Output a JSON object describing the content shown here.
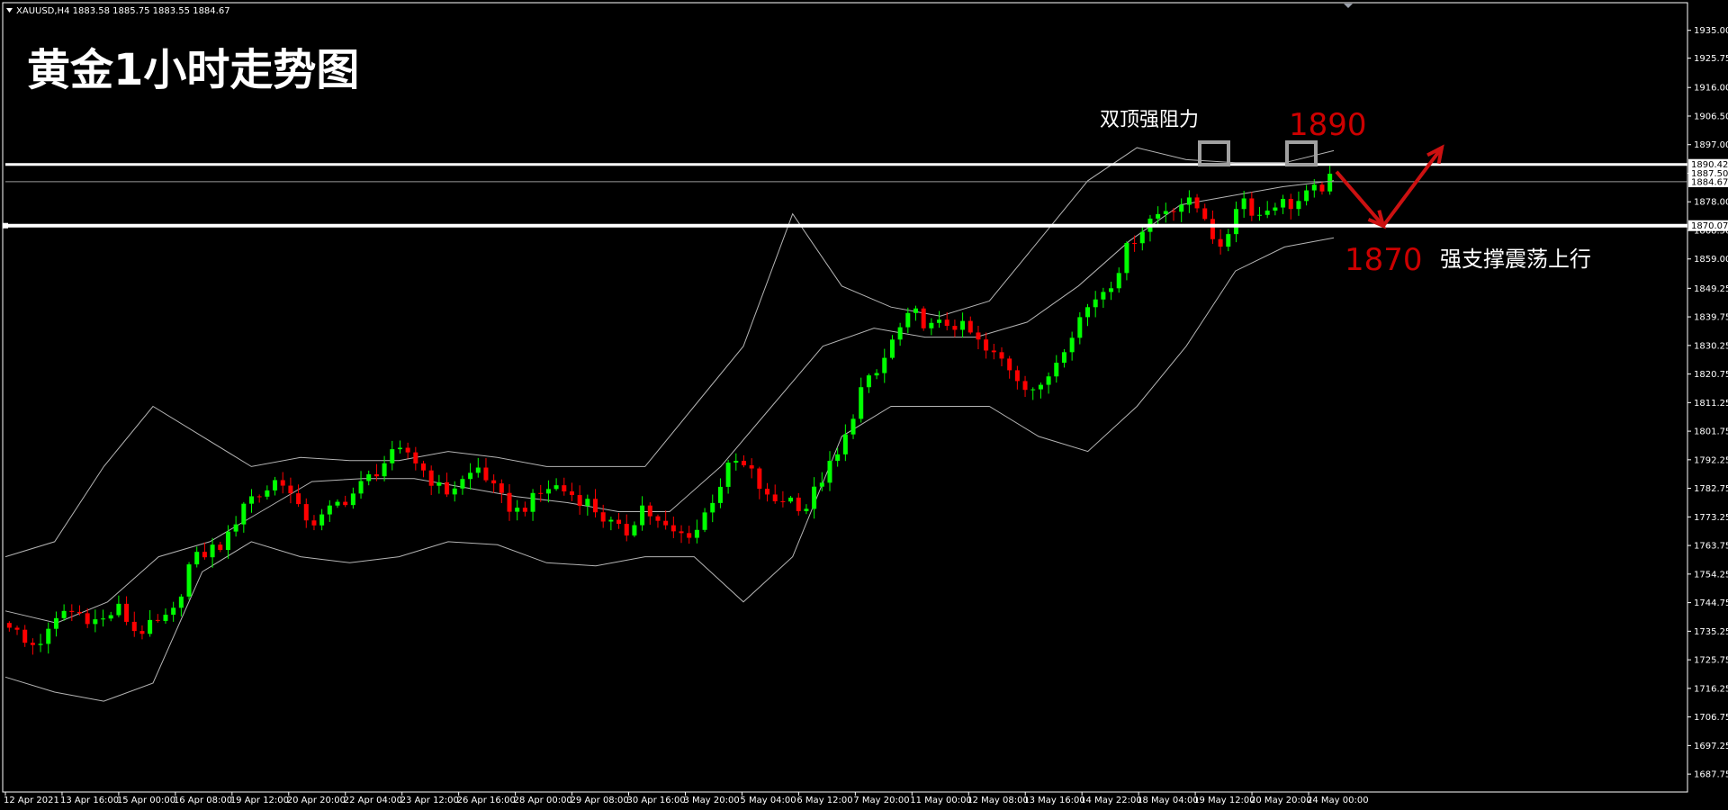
{
  "window": {
    "header": "XAUUSD,H4  1883.58 1885.75 1883.55 1884.67",
    "collapse_icon": "triangle-down-icon"
  },
  "annotations": {
    "title": "黄金1小时走势图",
    "resistance_label": "双顶强阻力",
    "resistance_price": "1890",
    "support_price": "1870",
    "support_label": "强支撑震荡上行"
  },
  "price_labels": {
    "resistance_line": "1890.42",
    "bid_line": "1887.50",
    "current": "1884.67",
    "support_line": "1870.07"
  },
  "colors": {
    "background": "#000000",
    "bull": "#00ff00",
    "bear": "#ff0000",
    "bands": "#b4b4b4",
    "level_lines": "#ffffff",
    "annotation_red": "#cc0000",
    "marker_box": "#a0a0a0"
  },
  "chart_data": {
    "type": "candlestick",
    "symbol": "XAUUSD",
    "timeframe": "H4",
    "ylim": [
      1683.0,
      1940.0
    ],
    "y_ticks": [
      "1935.00",
      "1925.75",
      "1916.00",
      "1906.50",
      "1897.00",
      "1887.50",
      "1878.00",
      "1868.50",
      "1859.00",
      "1849.25",
      "1839.75",
      "1830.25",
      "1820.75",
      "1811.25",
      "1801.75",
      "1792.25",
      "1782.75",
      "1773.25",
      "1763.75",
      "1754.25",
      "1744.75",
      "1735.25",
      "1725.75",
      "1716.25",
      "1706.75",
      "1697.25",
      "1687.75"
    ],
    "x_tick_labels": [
      "12 Apr 2021",
      "13 Apr 16:00",
      "15 Apr 00:00",
      "16 Apr 08:00",
      "19 Apr 12:00",
      "20 Apr 20:00",
      "22 Apr 04:00",
      "23 Apr 12:00",
      "26 Apr 16:00",
      "28 Apr 00:00",
      "29 Apr 08:00",
      "30 Apr 16:00",
      "3 May 20:00",
      "5 May 04:00",
      "6 May 12:00",
      "7 May 20:00",
      "11 May 00:00",
      "12 May 08:00",
      "13 May 16:00",
      "14 May 22:00",
      "18 May 04:00",
      "19 May 12:00",
      "20 May 20:00",
      "24 May 00:00"
    ],
    "close_path": [
      1738,
      1730,
      1733,
      1742,
      1741,
      1738,
      1743,
      1735,
      1737,
      1740,
      1758,
      1762,
      1765,
      1779,
      1781,
      1787,
      1775,
      1771,
      1777,
      1781,
      1787,
      1793,
      1795,
      1788,
      1781,
      1785,
      1790,
      1780,
      1775,
      1779,
      1784,
      1781,
      1778,
      1772,
      1767,
      1777,
      1770,
      1767,
      1769,
      1781,
      1792,
      1788,
      1778,
      1780,
      1776,
      1787,
      1795,
      1815,
      1821,
      1834,
      1841,
      1836,
      1838,
      1835,
      1828,
      1825,
      1818,
      1815,
      1827,
      1838,
      1846,
      1852,
      1865,
      1872,
      1876,
      1878,
      1875,
      1860,
      1881,
      1873,
      1878,
      1877,
      1881,
      1885
    ],
    "bands_upper": [
      1760,
      1765,
      1790,
      1810,
      1800,
      1790,
      1793,
      1792,
      1792,
      1795,
      1793,
      1790,
      1790,
      1790,
      1810,
      1830,
      1874,
      1850,
      1843,
      1840,
      1845,
      1865,
      1885,
      1896,
      1892,
      1891,
      1891,
      1895
    ],
    "bands_middle": [
      1742,
      1738,
      1745,
      1760,
      1765,
      1775,
      1785,
      1786,
      1786,
      1783,
      1780,
      1778,
      1775,
      1775,
      1790,
      1810,
      1830,
      1836,
      1833,
      1833,
      1838,
      1850,
      1865,
      1877,
      1880,
      1883,
      1885
    ],
    "bands_lower": [
      1720,
      1715,
      1712,
      1718,
      1755,
      1765,
      1760,
      1758,
      1760,
      1765,
      1764,
      1758,
      1757,
      1760,
      1760,
      1745,
      1760,
      1800,
      1810,
      1810,
      1810,
      1800,
      1795,
      1810,
      1830,
      1855,
      1863,
      1866
    ],
    "levels": {
      "resistance": 1890.42,
      "support": 1870.07,
      "current": 1884.67
    },
    "forecast_path": [
      1888,
      1870,
      1896
    ]
  }
}
